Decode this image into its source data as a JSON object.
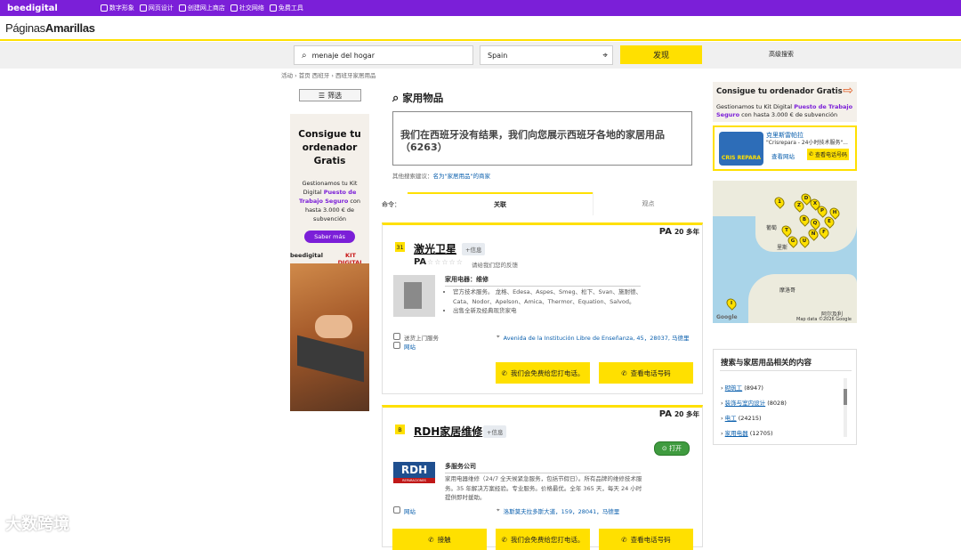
{
  "topbar": {
    "brand": "beedigital",
    "nav": [
      "数字形象",
      "网页设计",
      "创建网上商店",
      "社交网络",
      "免费工具"
    ]
  },
  "header": {
    "logo_light": "Páginas",
    "logo_bold": "Amarillas"
  },
  "search": {
    "what_value": "menaje del hogar",
    "where_value": "Spain",
    "button": "发现",
    "advanced": "高级搜索"
  },
  "breadcrumb": "活动 › 首页 西班牙 › 西班牙家居用品",
  "filter_label": "筛选",
  "left_ad": {
    "headline": "Consigue tu ordenador Gratis",
    "text_a": "Gestionamos tu Kit Digital ",
    "text_b": "Puesto de Trabajo Seguro",
    "text_c": " con hasta 3.000 € de subvención",
    "button": "Saber más",
    "logo1": "beedigital",
    "logo2": "KIT DIGITAL"
  },
  "main": {
    "title": "家用物品",
    "notice": "我们在西班牙没有结果，我们向您展示西班牙各地的家居用品（6263）",
    "other_prefix": "其他搜索建议：",
    "other_link": "名为\"家居用品\"的商家",
    "sort_label": "命令：",
    "sort_tabs": [
      "关联",
      "观点"
    ]
  },
  "listings": [
    {
      "num": "㉛",
      "name": "激光卫星",
      "info": "+信息",
      "years": "20 多年",
      "rating_text": "请给我们您的反馈",
      "category": "家用电器：维修",
      "bullets": [
        "官方技术服务。 龙格、Edesa、Aspes、Smeg、松下、Svan、施耐德、Cata、Nodor、Apelson、Amica、Thermor、Equation、Salvod。",
        "出售全新及经典现货家电"
      ],
      "service": "送货上门服务",
      "web": "网站",
      "address": "Avenida de la Institución Libre de Enseñanza, 45，28037, 马德里",
      "btn_call": "我们会免费给您打电话。",
      "btn_phone": "查看电话号码"
    },
    {
      "num": "B",
      "name": "RDH家居维修",
      "info": "+信息",
      "years": "20 多年",
      "open": "打开",
      "logo": "RDH",
      "logo_sub": "REPARACIONES",
      "category": "多服务公司",
      "desc": "家用电器维修（24/7 全天候紧急服务，包括节假日）。所有品牌的维修技术服务。35 年解决方案经验。专业服务。价格最优。全年 365 天，每天 24 小时提供即时援助。",
      "web": "网站",
      "address": "洛斯莫夫拉多斯大道，159，28041，马德里",
      "btn_contact": "接触",
      "btn_call": "我们会免费给您打电话。",
      "btn_phone": "查看电话号码"
    }
  ],
  "right_ad": {
    "headline": "Consigue tu ordenador Gratis",
    "text_a": "Gestionamos tu Kit Digital ",
    "text_b": "Puesto de Trabajo Seguro",
    "text_c": " con hasta 3.000 € de subvención"
  },
  "sponsor": {
    "logo_text": "CRIS REPARA",
    "name": "克里斯雷帕拉",
    "desc": "\"Crisrepara - 24小时技术服务\"...",
    "web": "查看网站",
    "phone": "查看电话号码"
  },
  "map": {
    "labels": [
      "葡萄",
      "里斯",
      "摩洛哥",
      "阿尔及利",
      "Google",
      "Map data ©2026 Google"
    ],
    "pins": [
      "1",
      "D",
      "Z",
      "X",
      "P",
      "H",
      "B",
      "Q",
      "G",
      "T",
      "U",
      "N",
      "F",
      "E",
      "I"
    ]
  },
  "related": {
    "title": "搜索与家居用品相关的内容",
    "items": [
      {
        "label": "砌筑工",
        "count": "(8947)"
      },
      {
        "label": "装饰与室内设计",
        "count": "(8028)"
      },
      {
        "label": "电工",
        "count": "(24215)"
      },
      {
        "label": "家用电器",
        "count": "(12705)"
      }
    ]
  },
  "watermark": "大数跨境"
}
